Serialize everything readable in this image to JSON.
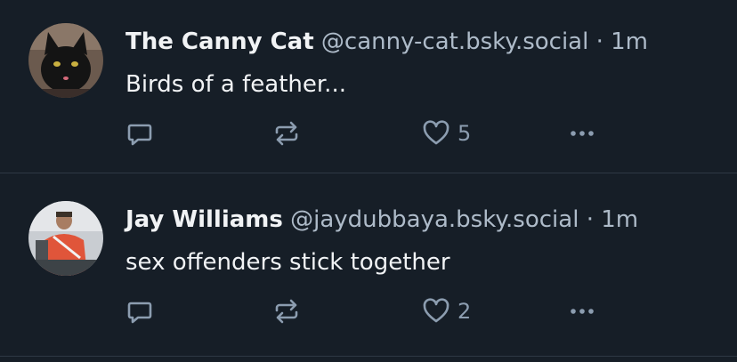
{
  "posts": [
    {
      "author_name": "The Canny Cat",
      "handle": "@canny-cat.bsky.social",
      "separator": "·",
      "time": "1m",
      "text": "Birds of a feather...",
      "like_count": "5",
      "avatar_icon": "black-cat-avatar"
    },
    {
      "author_name": "Jay Williams",
      "handle": "@jaydubbaya.bsky.social",
      "separator": "·",
      "time": "1m",
      "text": "sex offenders stick together",
      "like_count": "2",
      "avatar_icon": "person-avatar"
    }
  ],
  "icons": {
    "reply": "reply-icon",
    "repost": "repost-icon",
    "like": "heart-icon",
    "more": "more-options-icon"
  },
  "colors": {
    "background": "#161e27",
    "name": "#f1f3f5",
    "secondary": "#aebbc9",
    "icon": "#8c9db0",
    "divider": "#2e3844"
  }
}
